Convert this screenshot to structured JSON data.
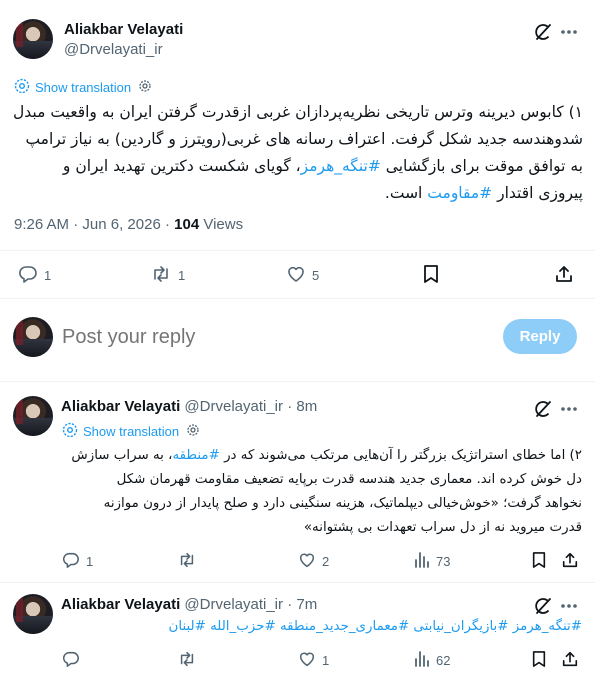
{
  "main_tweet": {
    "author_name": "Aliakbar Velayati",
    "author_handle": "@Drvelayati_ir",
    "show_translation": "Show translation",
    "text_lines": [
      "۱) کابوس دیرینه وترس تاریخی نظریه‌پردازان غربی ازقدرت گرفتن ایران به واقعیت مبدل",
      "شدوهندسه جدید شکل گرفت. اعتراف رسانه های غربی(رویترز و گاردین) به نیاز ترامپ",
      "به توافق موقت برای بازگشایی #تنگه_هرمز، گویای شکست دکترین تهدید ایران و",
      "پیروزی اقتدار #مقاومت است."
    ],
    "hashtags": [
      "#تنگه_هرمز",
      "#مقاومت"
    ],
    "time": "9:26 AM",
    "date": "Jun 6, 2026",
    "views_count": "104",
    "views_label": "Views",
    "separator": "·",
    "replies": "1",
    "reposts": "1",
    "likes": "5"
  },
  "composer": {
    "placeholder": "Post your reply",
    "reply_button": "Reply"
  },
  "replies": [
    {
      "author_name": "Aliakbar Velayati",
      "author_handle": "@Drvelayati_ir",
      "age": "8m",
      "show_translation": "Show translation",
      "text_lines": [
        "۲) اما خطای استراتژیک بزرگتر را آن‌هایی مرتکب می‌شوند که در #منطقه، به سراب سازش",
        "دل خوش کرده اند. معماری جدید هندسه قدرت برپایه تضعیف مقاومت قهرمان شکل",
        "نخواهد گرفت؛ «خوش‌خیالی دیپلماتیک، هزینه سنگینی دارد و صلح پایدار از درون موازنه",
        "قدرت میروید نه از دل سراب تعهدات بی پشتوانه»"
      ],
      "replies": "1",
      "reposts": "",
      "likes": "2",
      "views": "73"
    },
    {
      "author_name": "Aliakbar Velayati",
      "author_handle": "@Drvelayati_ir",
      "age": "7m",
      "text_lines": [
        "#تنگه_هرمز #بازیگران_نیابتی #معماری_جدید_منطقه #حزب_الله #لبنان"
      ],
      "replies": "",
      "reposts": "",
      "likes": "1",
      "views": "62"
    }
  ],
  "icons": {
    "grok": "grok-slash-icon",
    "more": "more-dots-icon",
    "translate": "translate-gear-icon",
    "reply": "reply-bubble-icon",
    "repost": "repost-arrows-icon",
    "like": "heart-icon",
    "views": "views-bars-icon",
    "bookmark": "bookmark-icon",
    "share": "share-upload-icon"
  },
  "colors": {
    "link": "#1d9bf0",
    "muted": "#536471",
    "reply_button_bg": "#8ecdf8"
  }
}
